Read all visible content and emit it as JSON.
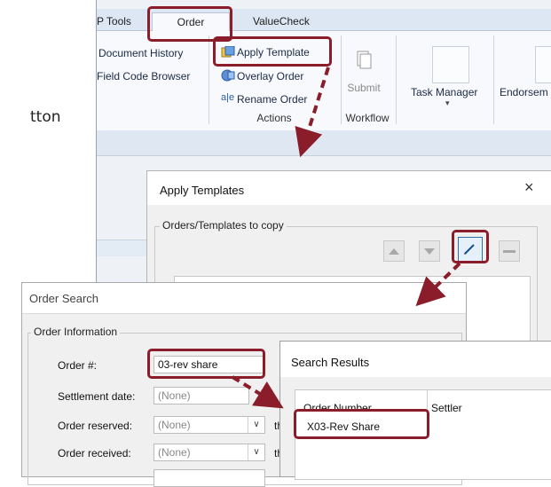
{
  "background_text": "tton",
  "ribbon": {
    "tabs": [
      "P Tools",
      "Order",
      "ValueCheck"
    ],
    "left_items": [
      "Document History",
      "Field Code Browser"
    ],
    "actions": [
      "Apply Template",
      "Overlay Order",
      "Rename Order"
    ],
    "actions_group_label": "Actions",
    "workflow_button": "Submit",
    "workflow_group_label": "Workflow",
    "task_manager": "Task Manager",
    "endorse": "Endorsem"
  },
  "apply_dialog": {
    "title": "Apply Templates",
    "close": "×",
    "fieldset_legend": "Orders/Templates to copy"
  },
  "order_search": {
    "title": "Order Search",
    "legend": "Order Information",
    "fields": [
      {
        "label": "Order #:",
        "value": "03-rev share"
      },
      {
        "label": "Settlement date:",
        "value": "(None)",
        "after": "th"
      },
      {
        "label": "Order reserved:",
        "value": "(None)",
        "after": "th"
      },
      {
        "label": "Order received:",
        "value": "(None)",
        "after": "th"
      }
    ]
  },
  "search_results": {
    "title": "Search Results",
    "columns": [
      "Order Number",
      "Settler"
    ],
    "rows": [
      [
        "X03-Rev Share"
      ]
    ]
  },
  "colors": {
    "highlight": "#8b1c2a",
    "accent": "#2b6cb0"
  }
}
